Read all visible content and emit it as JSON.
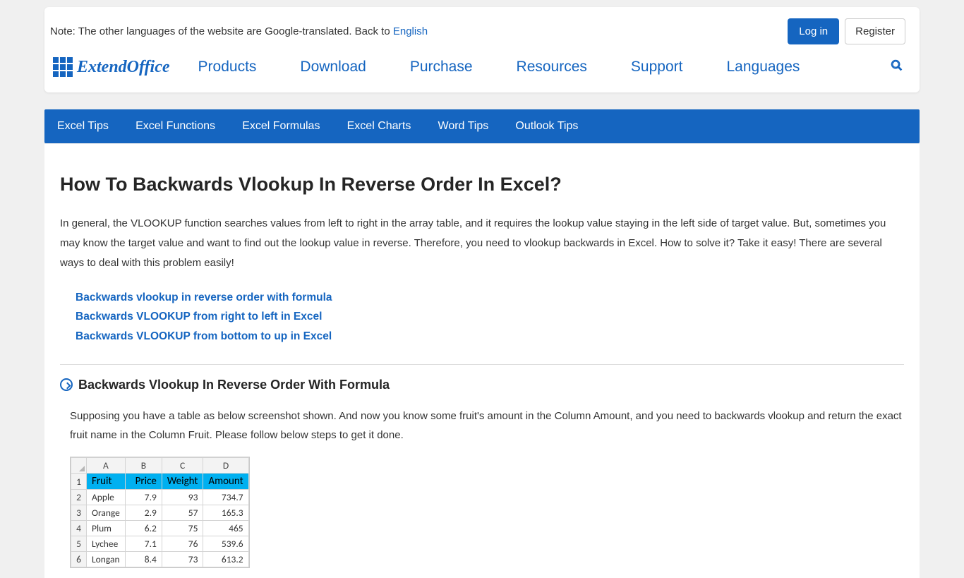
{
  "note": {
    "prefix": "Note: The other languages of the website are Google-translated. Back to ",
    "link": "English"
  },
  "auth": {
    "login": "Log in",
    "register": "Register"
  },
  "logo": {
    "text": "ExtendOffice"
  },
  "nav": {
    "items": [
      "Products",
      "Download",
      "Purchase",
      "Resources",
      "Support",
      "Languages"
    ]
  },
  "subnav": {
    "items": [
      "Excel Tips",
      "Excel Functions",
      "Excel Formulas",
      "Excel Charts",
      "Word Tips",
      "Outlook Tips"
    ]
  },
  "article": {
    "title": "How To Backwards Vlookup In Reverse Order In Excel?",
    "intro": "In general, the VLOOKUP function searches values from left to right in the array table, and it requires the lookup value staying in the left side of target value. But, sometimes you may know the target value and want to find out the lookup value in reverse. Therefore, you need to vlookup backwards in Excel. How to solve it? Take it easy! There are several ways to deal with this problem easily!",
    "toc": [
      "Backwards vlookup in reverse order with formula",
      "Backwards VLOOKUP from right to left in Excel",
      "Backwards VLOOKUP from bottom to up in Excel"
    ],
    "section1": {
      "heading": "Backwards Vlookup In Reverse Order With Formula",
      "body": "Supposing you have a table as below screenshot shown. And now you know some fruit's amount in the Column Amount, and you need to backwards vlookup and return the exact fruit name in the Column Fruit. Please follow below steps to get it done."
    }
  },
  "excel": {
    "cols": [
      "A",
      "B",
      "C",
      "D"
    ],
    "headers": [
      "Fruit",
      "Price",
      "Weight",
      "Amount"
    ],
    "rows": [
      {
        "n": "2",
        "fruit": "Apple",
        "price": "7.9",
        "weight": "93",
        "amount": "734.7"
      },
      {
        "n": "3",
        "fruit": "Orange",
        "price": "2.9",
        "weight": "57",
        "amount": "165.3"
      },
      {
        "n": "4",
        "fruit": "Plum",
        "price": "6.2",
        "weight": "75",
        "amount": "465"
      },
      {
        "n": "5",
        "fruit": "Lychee",
        "price": "7.1",
        "weight": "76",
        "amount": "539.6"
      },
      {
        "n": "6",
        "fruit": "Longan",
        "price": "8.4",
        "weight": "73",
        "amount": "613.2"
      }
    ]
  }
}
